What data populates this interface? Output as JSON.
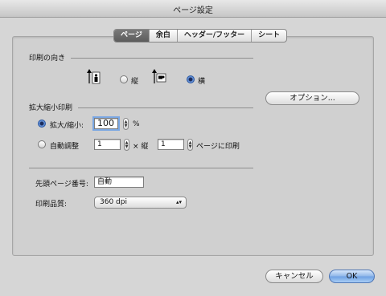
{
  "window": {
    "title": "ページ設定"
  },
  "tabs": [
    {
      "label": "ページ",
      "active": true
    },
    {
      "label": "余白",
      "active": false
    },
    {
      "label": "ヘッダー/フッター",
      "active": false
    },
    {
      "label": "シート",
      "active": false
    }
  ],
  "orientation": {
    "heading": "印刷の向き",
    "portrait_label": "縦",
    "landscape_label": "横",
    "selected": "landscape"
  },
  "scaling": {
    "heading": "拡大縮小印刷",
    "zoom_label": "拡大/縮小:",
    "zoom_value": "100",
    "zoom_unit": "%",
    "fit_label": "自動調整",
    "fit_width": "1",
    "by_label": "× 縦",
    "fit_height": "1",
    "pages_label": "ページに印刷",
    "selected": "zoom"
  },
  "options_button": "オプション...",
  "first_page": {
    "label": "先頭ページ番号:",
    "value": "自動"
  },
  "quality": {
    "label": "印刷品質:",
    "value": "360 dpi"
  },
  "buttons": {
    "cancel": "キャンセル",
    "ok": "OK"
  },
  "colors": {
    "accent": "#6da0e3"
  }
}
